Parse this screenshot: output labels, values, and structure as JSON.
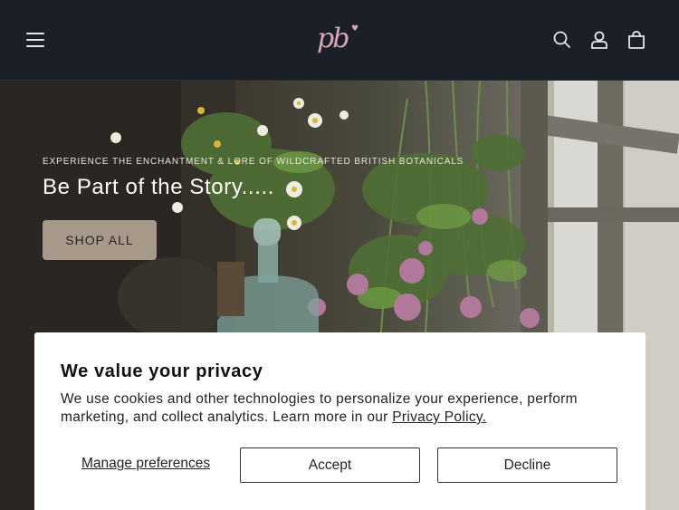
{
  "header": {
    "logo_text": "pb",
    "icons": [
      "hamburger-menu-icon",
      "search-icon",
      "account-icon",
      "cart-icon"
    ]
  },
  "hero": {
    "kicker": "EXPERIENCE THE ENCHANTMENT & LORE OF WILDCRAFTED BRITISH BOTANICALS",
    "title": "Be Part of the Story.....",
    "cta_label": "SHOP ALL"
  },
  "cookie_banner": {
    "title": "We value your privacy",
    "body": "We use cookies and other technologies to personalize your experience, perform marketing, and collect analytics. Learn more in our ",
    "policy_link": "Privacy Policy.",
    "manage_label": "Manage preferences",
    "accept_label": "Accept",
    "decline_label": "Decline"
  },
  "colors": {
    "header_bg": "#1b1f27",
    "logo_pink": "#d8a6b7",
    "cta_bg": "#a79a8b"
  }
}
